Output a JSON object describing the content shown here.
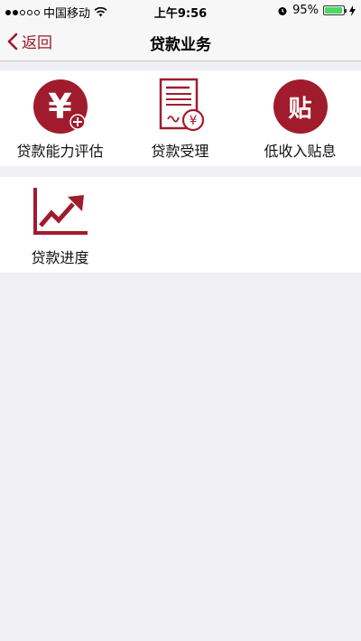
{
  "status_bar": {
    "carrier": "中国移动",
    "time": "上午9:56",
    "battery": "95%",
    "battery_level": 0.95
  },
  "nav": {
    "back_label": "返回",
    "title": "贷款业务"
  },
  "services": {
    "row1": [
      {
        "label": "贷款能力评估",
        "icon": "yuan-plus-icon"
      },
      {
        "label": "贷款受理",
        "icon": "document-yuan-icon"
      },
      {
        "label": "低收入贴息",
        "icon": "tie-icon"
      }
    ],
    "row2": [
      {
        "label": "贷款进度",
        "icon": "trend-chart-icon"
      }
    ]
  },
  "icon_glyphs": {
    "yuan": "¥",
    "tie": "贴"
  },
  "colors": {
    "accent": "#a01c2d",
    "background": "#efeff4"
  }
}
